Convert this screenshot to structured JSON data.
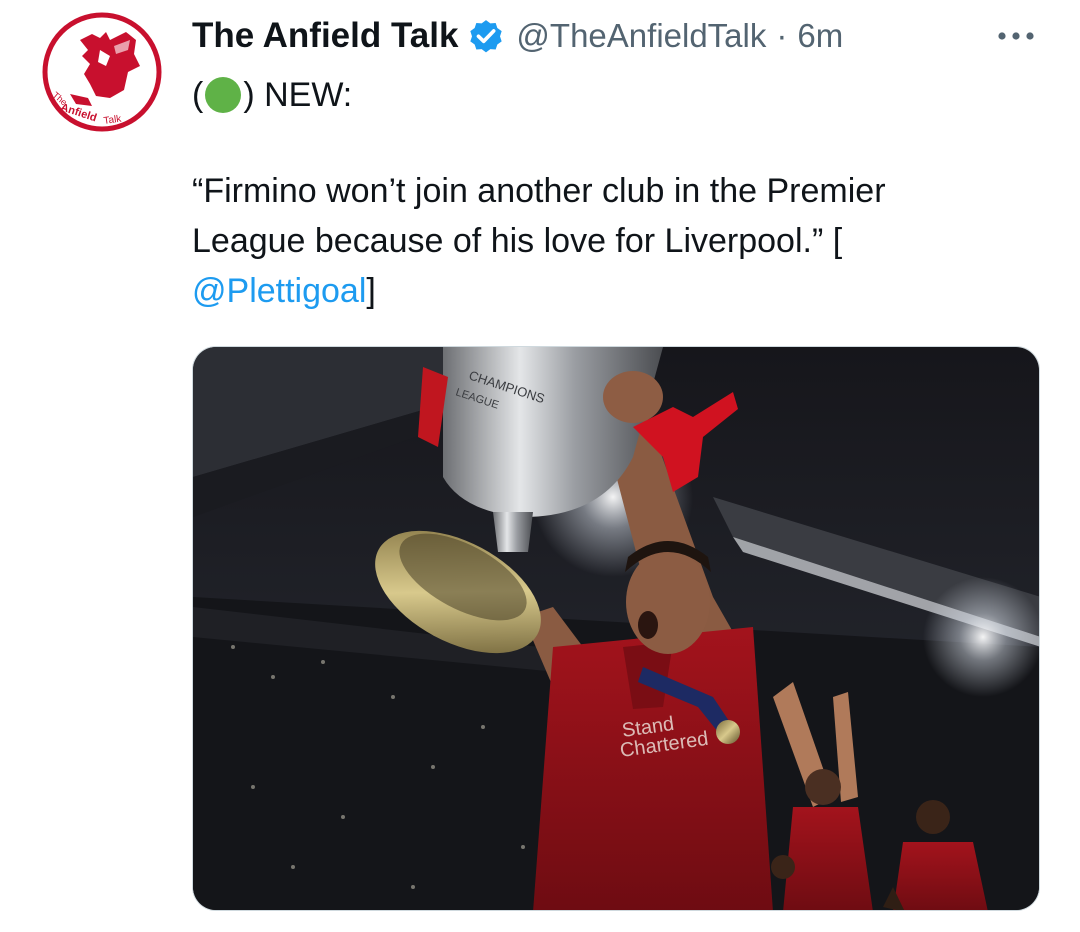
{
  "tweet": {
    "display_name": "The Anfield Talk",
    "handle": "@TheAnfieldTalk",
    "separator": "·",
    "time": "6m",
    "line1_open": "(",
    "line1_close": ") NEW:",
    "quote_line1": "“Firmino won’t join another club in the Premier",
    "quote_line2": "League because of his love for Liverpool.” [",
    "mention": "@Plettigoal",
    "mention_close": "]"
  },
  "avatar": {
    "logo_text_the": "The",
    "logo_text_anfield": "Anfield",
    "logo_text_talk": "Talk"
  },
  "media": {
    "trophy_text_1": "CHAMPIONS",
    "trophy_text_2": "LEAGUE",
    "shirt_text_1": "Stand",
    "shirt_text_2": "Chartered"
  },
  "icons": {
    "verified": "verified-badge-icon",
    "more": "more-options-icon",
    "status": "green-circle-icon"
  },
  "colors": {
    "accent": "#1d9bf0",
    "muted": "#536471",
    "logo_red": "#c8102e",
    "status_green": "#5fb247"
  }
}
